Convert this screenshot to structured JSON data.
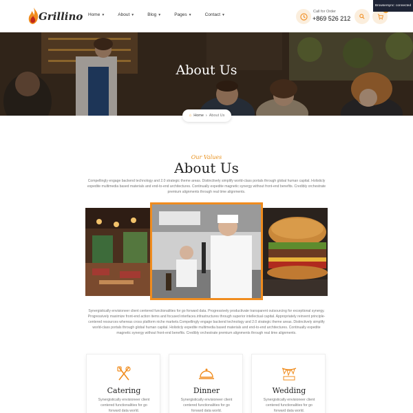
{
  "brand": {
    "name": "Grillino",
    "accent": "#f08c1e"
  },
  "nav": {
    "items": [
      {
        "label": "Home"
      },
      {
        "label": "About"
      },
      {
        "label": "Blog"
      },
      {
        "label": "Pages"
      },
      {
        "label": "Contact"
      }
    ]
  },
  "call": {
    "label": "Call for Order",
    "number": "+869 526 212"
  },
  "status": {
    "text": "Browsersync: connected"
  },
  "cart": {
    "count": "0"
  },
  "hero": {
    "title": "About Us"
  },
  "breadcrumb": {
    "home": "Home",
    "separator": "›",
    "current": "About Us"
  },
  "about": {
    "subtag": "Our Values",
    "title": "About Us",
    "para1": "Compellingly engage backend technology and 2.0 strategic theme areas. Distinctively simplify world-class portals through global human capital. Holisticly expedite multimedia based materials and end-to-end architectures. Continually expedite magnetic synergy without front-end benefits. Credibly orchestrate premium alignments through real time alignments.",
    "para2": "Synergistically envisioneer client centered functionalities for go forward data. Progressively productivate transparent outsourcing for exceptional synergy. Progressively maximize front-end action items and focused interfaces.infrastructures through superior intellectual capital. Appropriately reinvent principle-centered resources whereas cross platform niche markets.Compellingly engage backend technology and 2.0 strategic theme areas. Distinctively simplify world-class portals through global human capital. Holisticly expedite multimedia based materials and end-to-end architectures. Continually expedite magnetic synergy without front-end benefits. Credibly orchestrate premium alignments through real time alignments."
  },
  "cards": [
    {
      "title": "Catering",
      "text": "Synergistically envisioneer client centered functionalities for go forward data world.",
      "icon": "catering-icon"
    },
    {
      "title": "Dinner",
      "text": "Synergistically envisioneer client centered functionalities for go forward data world.",
      "icon": "cloche-icon"
    },
    {
      "title": "Wedding",
      "text": "Synergistically envisioneer client centered functionalities for go forward data world.",
      "icon": "wedding-icon"
    }
  ]
}
